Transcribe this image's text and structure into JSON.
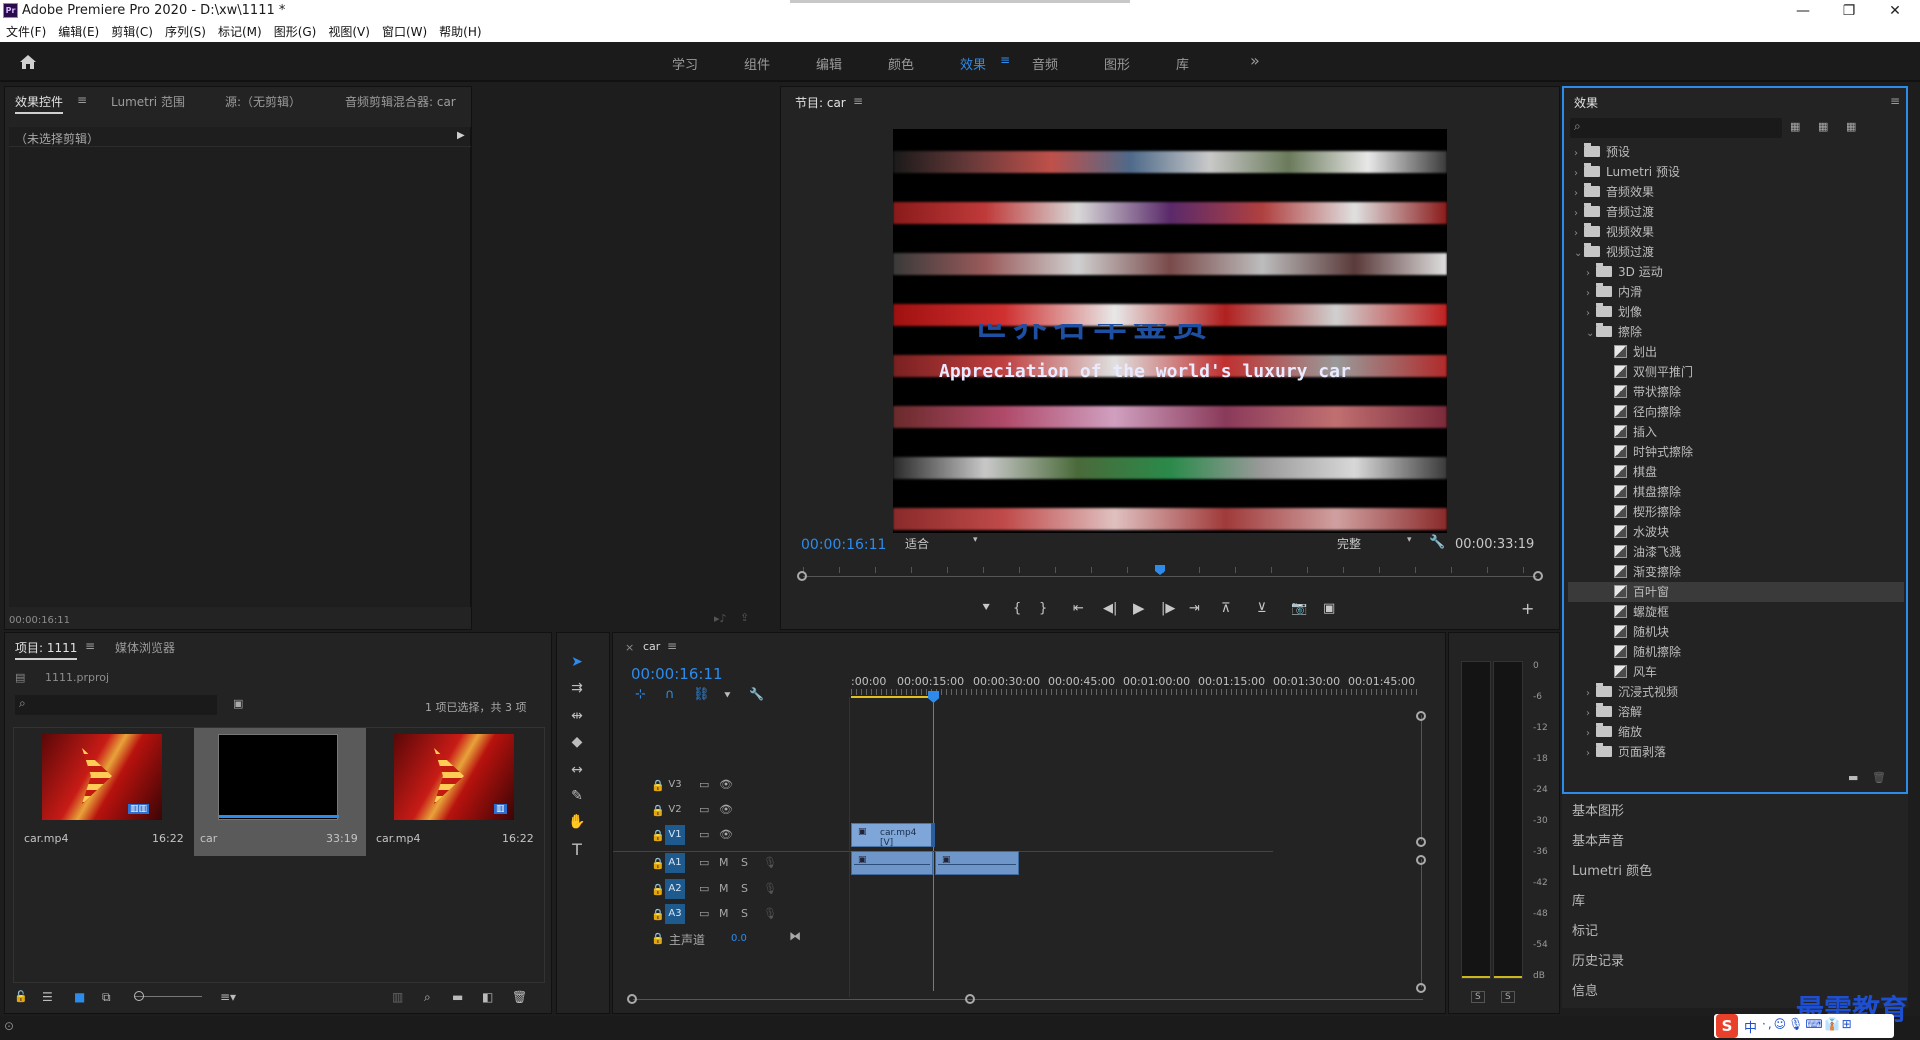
{
  "app": {
    "title": "Adobe Premiere Pro 2020 - D:\\xw\\1111 *",
    "logo": "Pr",
    "window_controls": [
      "—",
      "❐",
      "✕"
    ]
  },
  "menu": [
    "文件(F)",
    "编辑(E)",
    "剪辑(C)",
    "序列(S)",
    "标记(M)",
    "图形(G)",
    "视图(V)",
    "窗口(W)",
    "帮助(H)"
  ],
  "workspaces": {
    "tabs": [
      "学习",
      "组件",
      "编辑",
      "颜色",
      "效果",
      "音频",
      "图形",
      "库"
    ],
    "active": "效果",
    "more": "»"
  },
  "effect_controls": {
    "tabs": [
      "效果控件",
      "Lumetri 范围",
      "源:（无剪辑）",
      "音频剪辑混合器: car"
    ],
    "no_clip": "（未选择剪辑）",
    "timecode": "00:00:16:11"
  },
  "program": {
    "title": "节目: car",
    "overlay_text_cn": "世界名车鉴赏",
    "overlay_text_en": "Appreciation of the world's luxury car",
    "current_time": "00:00:16:11",
    "fit": "适合",
    "quality": "完整",
    "duration": "00:00:33:19",
    "playhead_fraction": 0.485
  },
  "project": {
    "tabs": [
      "项目: 1111",
      "媒体浏览器"
    ],
    "file": "1111.prproj",
    "selection_status": "1 项已选择，共 3 项",
    "items": [
      {
        "name": "car.mp4",
        "duration": "16:22"
      },
      {
        "name": "car",
        "duration": "33:19"
      },
      {
        "name": "car.mp4",
        "duration": "16:22"
      }
    ]
  },
  "timeline": {
    "tab": "car",
    "timecode": "00:00:16:11",
    "ruler": [
      ":00:00",
      "00:00:15:00",
      "00:00:30:00",
      "00:00:45:00",
      "00:01:00:00",
      "00:01:15:00",
      "00:01:30:00",
      "00:01:45:00"
    ],
    "video_tracks": [
      "V3",
      "V2",
      "V1"
    ],
    "audio_tracks": [
      "A1",
      "A2",
      "A3"
    ],
    "mute": "M",
    "solo": "S",
    "master_label": "主声道",
    "master_value": "0.0",
    "clip_label": "car.mp4 [V]"
  },
  "effects_panel": {
    "title": "效果",
    "tree": [
      {
        "label": "预设",
        "level": 0,
        "type": "folder",
        "open": false
      },
      {
        "label": "Lumetri 预设",
        "level": 0,
        "type": "folder",
        "open": false
      },
      {
        "label": "音频效果",
        "level": 0,
        "type": "folder",
        "open": false
      },
      {
        "label": "音频过渡",
        "level": 0,
        "type": "folder",
        "open": false
      },
      {
        "label": "视频效果",
        "level": 0,
        "type": "folder",
        "open": false
      },
      {
        "label": "视频过渡",
        "level": 0,
        "type": "folder",
        "open": true
      },
      {
        "label": "3D 运动",
        "level": 1,
        "type": "folder",
        "open": false
      },
      {
        "label": "内滑",
        "level": 1,
        "type": "folder",
        "open": false
      },
      {
        "label": "划像",
        "level": 1,
        "type": "folder",
        "open": false
      },
      {
        "label": "擦除",
        "level": 1,
        "type": "folder",
        "open": true
      },
      {
        "label": "划出",
        "level": 2,
        "type": "effect"
      },
      {
        "label": "双侧平推门",
        "level": 2,
        "type": "effect"
      },
      {
        "label": "带状擦除",
        "level": 2,
        "type": "effect"
      },
      {
        "label": "径向擦除",
        "level": 2,
        "type": "effect"
      },
      {
        "label": "插入",
        "level": 2,
        "type": "effect"
      },
      {
        "label": "时钟式擦除",
        "level": 2,
        "type": "effect"
      },
      {
        "label": "棋盘",
        "level": 2,
        "type": "effect"
      },
      {
        "label": "棋盘擦除",
        "level": 2,
        "type": "effect"
      },
      {
        "label": "楔形擦除",
        "level": 2,
        "type": "effect"
      },
      {
        "label": "水波块",
        "level": 2,
        "type": "effect"
      },
      {
        "label": "油漆飞溅",
        "level": 2,
        "type": "effect"
      },
      {
        "label": "渐变擦除",
        "level": 2,
        "type": "effect"
      },
      {
        "label": "百叶窗",
        "level": 2,
        "type": "effect",
        "selected": true
      },
      {
        "label": "螺旋框",
        "level": 2,
        "type": "effect"
      },
      {
        "label": "随机块",
        "level": 2,
        "type": "effect"
      },
      {
        "label": "随机擦除",
        "level": 2,
        "type": "effect"
      },
      {
        "label": "风车",
        "level": 2,
        "type": "effect"
      },
      {
        "label": "沉浸式视频",
        "level": 1,
        "type": "folder",
        "open": false
      },
      {
        "label": "溶解",
        "level": 1,
        "type": "folder",
        "open": false
      },
      {
        "label": "缩放",
        "level": 1,
        "type": "folder",
        "open": false
      },
      {
        "label": "页面剥落",
        "level": 1,
        "type": "folder",
        "open": false
      }
    ],
    "lower_panels": [
      "基本图形",
      "基本声音",
      "Lumetri 颜色",
      "库",
      "标记",
      "历史记录",
      "信息"
    ]
  },
  "audio_meter": {
    "scale": [
      "0",
      "-6",
      "-12",
      "-18",
      "-24",
      "-30",
      "-36",
      "-42",
      "-48",
      "-54",
      "dB"
    ],
    "solo": [
      "S",
      "S"
    ]
  },
  "watermark": "最需教育",
  "ime": {
    "text": "中",
    "symbols": "·,☺🎙⌨👔⊞"
  },
  "colors": {
    "accent": "#2d8ceb",
    "panel": "#232323",
    "background": "#1d1d1d",
    "track_on": "#1f5a8f"
  }
}
